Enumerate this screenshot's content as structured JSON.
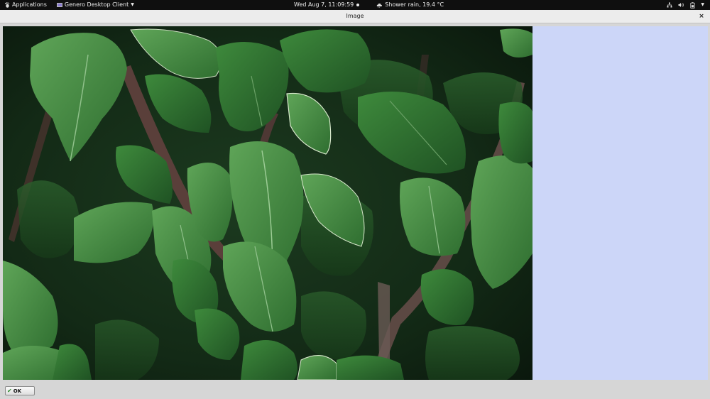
{
  "topbar": {
    "applications": "Applications",
    "app_name": "Genero Desktop Client",
    "datetime": "Wed Aug  7, 11:09:59",
    "weather": "Shower rain, 19.4 °C"
  },
  "window": {
    "title": "Image",
    "close": "×"
  },
  "panel": {
    "background_color": "#ccd6f8"
  },
  "buttons": {
    "ok_label": "OK"
  },
  "icons": {
    "apps": "gnome-foot-icon",
    "weather": "weather-cloud-icon",
    "network": "network-icon",
    "volume": "volume-icon",
    "battery": "battery-icon",
    "ok": "checkmark-icon"
  }
}
